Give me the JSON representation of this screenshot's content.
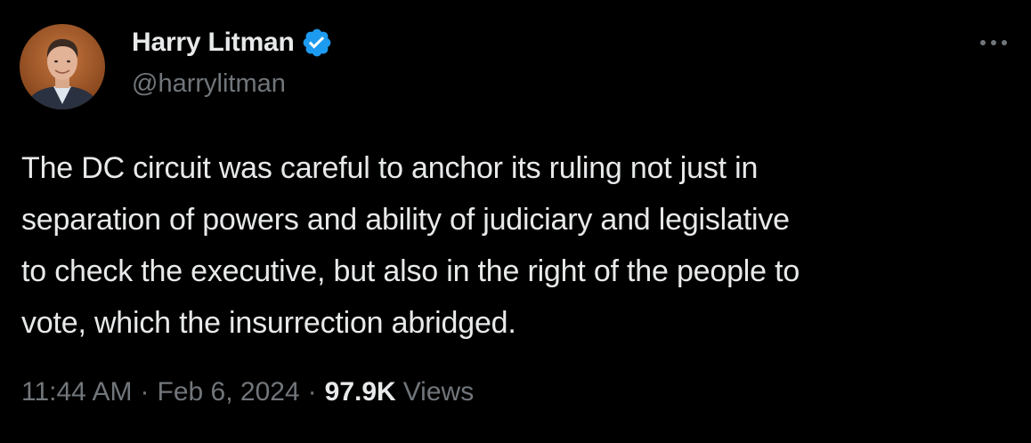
{
  "author": {
    "display_name": "Harry Litman",
    "handle": "@harrylitman",
    "verified": true,
    "verified_color": "#1d9bf0"
  },
  "tweet": {
    "text": "The DC circuit was careful to anchor its ruling not just in\nseparation of powers and ability of  judiciary and legislative\nto check the executive, but also in the right of the people to\nvote, which the insurrection abridged."
  },
  "meta": {
    "time": "11:44 AM",
    "separator": "·",
    "date": "Feb 6, 2024",
    "views_count": "97.9K",
    "views_label": "Views"
  },
  "icons": {
    "more": "more-horizontal-icon",
    "verified": "verified-badge-icon"
  },
  "colors": {
    "background": "#000000",
    "primary_text": "#e7e9ea",
    "secondary_text": "#71767b"
  }
}
